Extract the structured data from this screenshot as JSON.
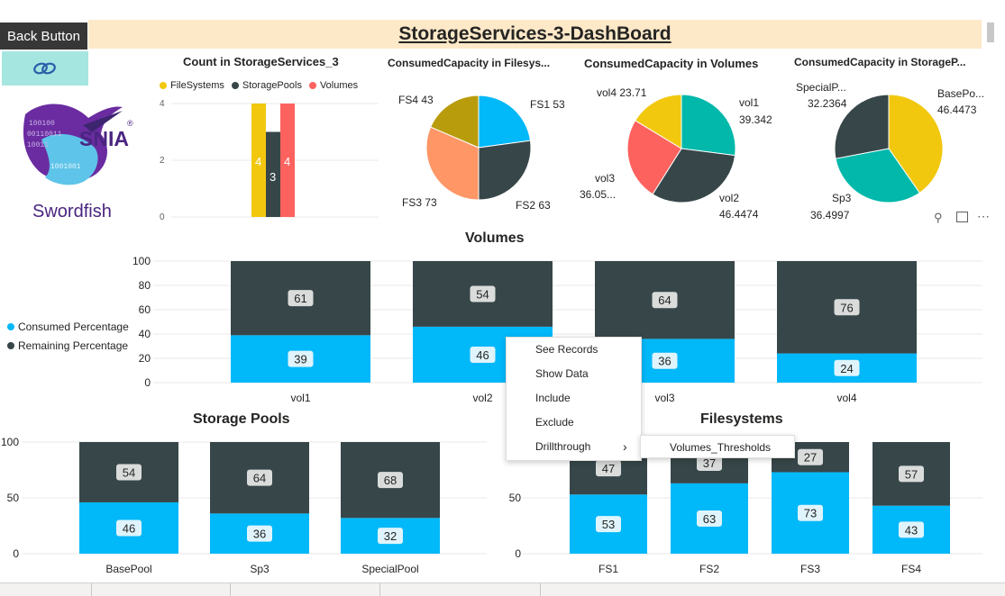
{
  "header": {
    "back_button": "Back Button",
    "title": "StorageServices-3-DashBoard"
  },
  "logo": {
    "snia": "SNIA",
    "swordfish": "Swordfish",
    "reg": "®"
  },
  "count_chart": {
    "title": "Count in StorageServices_3",
    "legend": [
      {
        "name": "FileSystems",
        "color": "#f2c80f"
      },
      {
        "name": "StoragePools",
        "color": "#374649"
      },
      {
        "name": "Volumes",
        "color": "#fd625e"
      }
    ],
    "y_ticks": [
      "4",
      "2",
      "0"
    ],
    "bar_labels": [
      "4",
      "3",
      "4"
    ]
  },
  "pies": {
    "filesystems": {
      "title": "ConsumedCapacity  in Filesys...",
      "labels": {
        "fs1": "FS1 53",
        "fs2": "FS2 63",
        "fs3": "FS3 73",
        "fs4": "FS4 43"
      }
    },
    "volumes": {
      "title": "ConsumedCapacity in Volumes",
      "labels": {
        "vol1a": "vol1",
        "vol1b": "39.342",
        "vol2a": "vol2",
        "vol2b": "46.4474",
        "vol3a": "vol3",
        "vol3b": "36.05...",
        "vol4": "vol4 23.71"
      }
    },
    "pools": {
      "title": "ConsumedCapacity in StorageP...",
      "labels": {
        "basea": "BasePo...",
        "baseb": "46.4473",
        "sp3a": "Sp3",
        "sp3b": "36.4997",
        "speca": "SpecialP...",
        "specb": "32.2364"
      }
    }
  },
  "volumes_chart": {
    "title": "Volumes",
    "legend": [
      {
        "name": "Consumed Percentage",
        "color": "#01b8f9"
      },
      {
        "name": "Remaining Percentage",
        "color": "#374649"
      }
    ],
    "y_ticks": [
      "100",
      "80",
      "60",
      "40",
      "20",
      "0"
    ]
  },
  "pools_chart": {
    "title": "Storage Pools",
    "y_ticks": [
      "100",
      "50",
      "0"
    ]
  },
  "fs_chart": {
    "title": "Filesystems",
    "y_ticks": [
      "50",
      "0"
    ]
  },
  "chart_data": [
    {
      "type": "bar",
      "title": "Count in StorageServices_3",
      "categories": [
        ""
      ],
      "series": [
        {
          "name": "FileSystems",
          "values": [
            4
          ]
        },
        {
          "name": "StoragePools",
          "values": [
            3
          ]
        },
        {
          "name": "Volumes",
          "values": [
            4
          ]
        }
      ],
      "ylim": [
        0,
        4
      ]
    },
    {
      "type": "pie",
      "title": "ConsumedCapacity  in Filesys...",
      "categories": [
        "FS1",
        "FS2",
        "FS3",
        "FS4"
      ],
      "values": [
        53,
        63,
        73,
        43
      ],
      "colors": [
        "#01b8f9",
        "#374649",
        "#fe9666",
        "#b89c0c"
      ]
    },
    {
      "type": "pie",
      "title": "ConsumedCapacity in Volumes",
      "categories": [
        "vol1",
        "vol2",
        "vol3",
        "vol4"
      ],
      "values": [
        39.342,
        46.4474,
        36.05,
        23.71
      ],
      "colors": [
        "#01b8aa",
        "#374649",
        "#fd625e",
        "#f2c80f"
      ]
    },
    {
      "type": "pie",
      "title": "ConsumedCapacity in StorageP...",
      "categories": [
        "BasePool",
        "Sp3",
        "SpecialPool"
      ],
      "values": [
        46.4473,
        36.4997,
        32.2364
      ],
      "colors": [
        "#f2c80f",
        "#01b8aa",
        "#374649"
      ]
    },
    {
      "type": "bar",
      "stacked": true,
      "title": "Volumes",
      "categories": [
        "vol1",
        "vol2",
        "vol3",
        "vol4"
      ],
      "series": [
        {
          "name": "Consumed Percentage",
          "values": [
            39,
            46,
            36,
            24
          ],
          "color": "#01b8f9"
        },
        {
          "name": "Remaining Percentage",
          "values": [
            61,
            54,
            64,
            76
          ],
          "color": "#374649"
        }
      ],
      "ylim": [
        0,
        100
      ]
    },
    {
      "type": "bar",
      "stacked": true,
      "title": "Storage Pools",
      "categories": [
        "BasePool",
        "Sp3",
        "SpecialPool"
      ],
      "series": [
        {
          "name": "Consumed Percentage",
          "values": [
            46,
            36,
            32
          ],
          "color": "#01b8f9"
        },
        {
          "name": "Remaining Percentage",
          "values": [
            54,
            64,
            68
          ],
          "color": "#374649"
        }
      ],
      "ylim": [
        0,
        100
      ]
    },
    {
      "type": "bar",
      "stacked": true,
      "title": "Filesystems",
      "categories": [
        "FS1",
        "FS2",
        "FS3",
        "FS4"
      ],
      "series": [
        {
          "name": "Consumed Percentage",
          "values": [
            53,
            63,
            73,
            43
          ],
          "color": "#01b8f9"
        },
        {
          "name": "Remaining Percentage",
          "values": [
            47,
            37,
            27,
            57
          ],
          "color": "#374649"
        }
      ],
      "ylim": [
        0,
        100
      ]
    }
  ],
  "context_menu": {
    "items": [
      "See Records",
      "Show Data",
      "Include",
      "Exclude",
      "Drillthrough"
    ],
    "arrow": "›",
    "submenu_item": "Volumes_Thresholds"
  }
}
